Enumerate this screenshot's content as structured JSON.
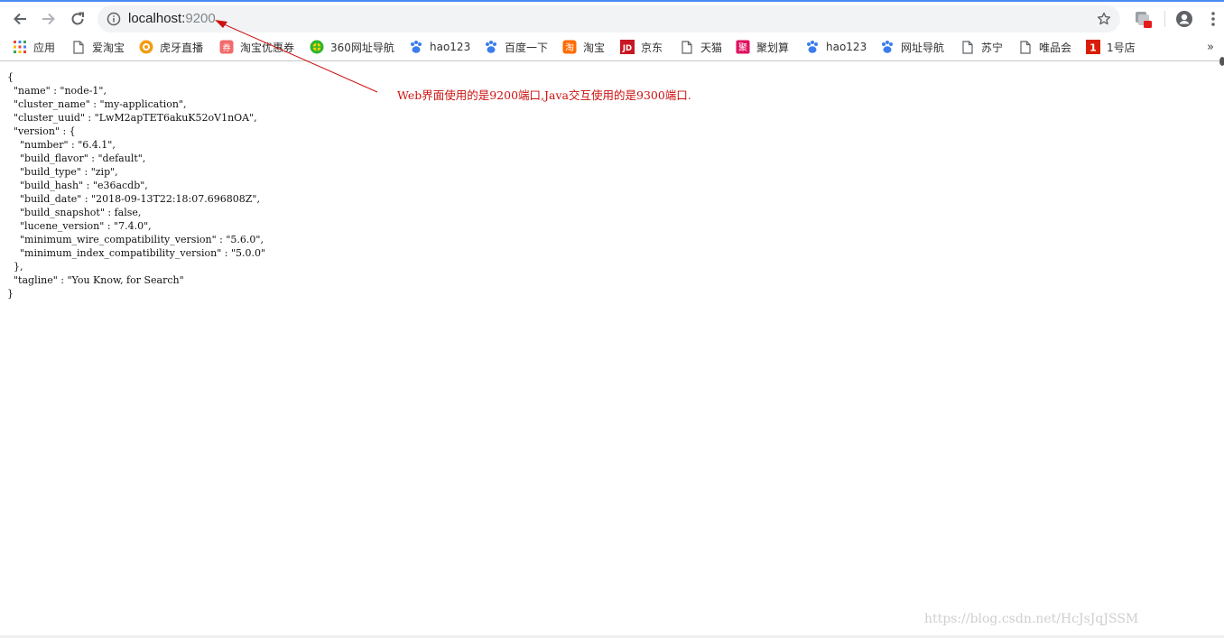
{
  "browser": {
    "url_host": "localhost:",
    "url_port": "9200"
  },
  "bookmarks": [
    {
      "label": "应用",
      "icon": "apps-grid-icon"
    },
    {
      "label": "爱淘宝",
      "icon": "page-icon"
    },
    {
      "label": "虎牙直播",
      "icon": "huya-icon"
    },
    {
      "label": "淘宝优惠券",
      "icon": "coupon-icon"
    },
    {
      "label": "360网址导航",
      "icon": "360-icon"
    },
    {
      "label": "hao123",
      "icon": "paw-icon"
    },
    {
      "label": "百度一下",
      "icon": "paw-icon"
    },
    {
      "label": "淘宝",
      "icon": "taobao-icon"
    },
    {
      "label": "京东",
      "icon": "jd-icon"
    },
    {
      "label": "天猫",
      "icon": "page-icon"
    },
    {
      "label": "聚划算",
      "icon": "juhuasuan-icon"
    },
    {
      "label": "hao123",
      "icon": "paw-icon"
    },
    {
      "label": "网址导航",
      "icon": "paw-icon"
    },
    {
      "label": "苏宁",
      "icon": "page-icon"
    },
    {
      "label": "唯品会",
      "icon": "page-icon"
    },
    {
      "label": "1号店",
      "icon": "yhd-icon"
    }
  ],
  "bookmarks_more": "»",
  "response_json": "{\n  \"name\" : \"node-1\",\n  \"cluster_name\" : \"my-application\",\n  \"cluster_uuid\" : \"LwM2apTET6akuK52oV1nOA\",\n  \"version\" : {\n    \"number\" : \"6.4.1\",\n    \"build_flavor\" : \"default\",\n    \"build_type\" : \"zip\",\n    \"build_hash\" : \"e36acdb\",\n    \"build_date\" : \"2018-09-13T22:18:07.696808Z\",\n    \"build_snapshot\" : false,\n    \"lucene_version\" : \"7.4.0\",\n    \"minimum_wire_compatibility_version\" : \"5.6.0\",\n    \"minimum_index_compatibility_version\" : \"5.0.0\"\n  },\n  \"tagline\" : \"You Know, for Search\"\n}",
  "annotation": "Web界面使用的是9200端口,Java交互使用的是9300端口.",
  "watermark": "https://blog.csdn.net/HcJsJqJSSM",
  "colors": {
    "annotation": "#cc1111",
    "tab_accent": "#4a8af4"
  }
}
